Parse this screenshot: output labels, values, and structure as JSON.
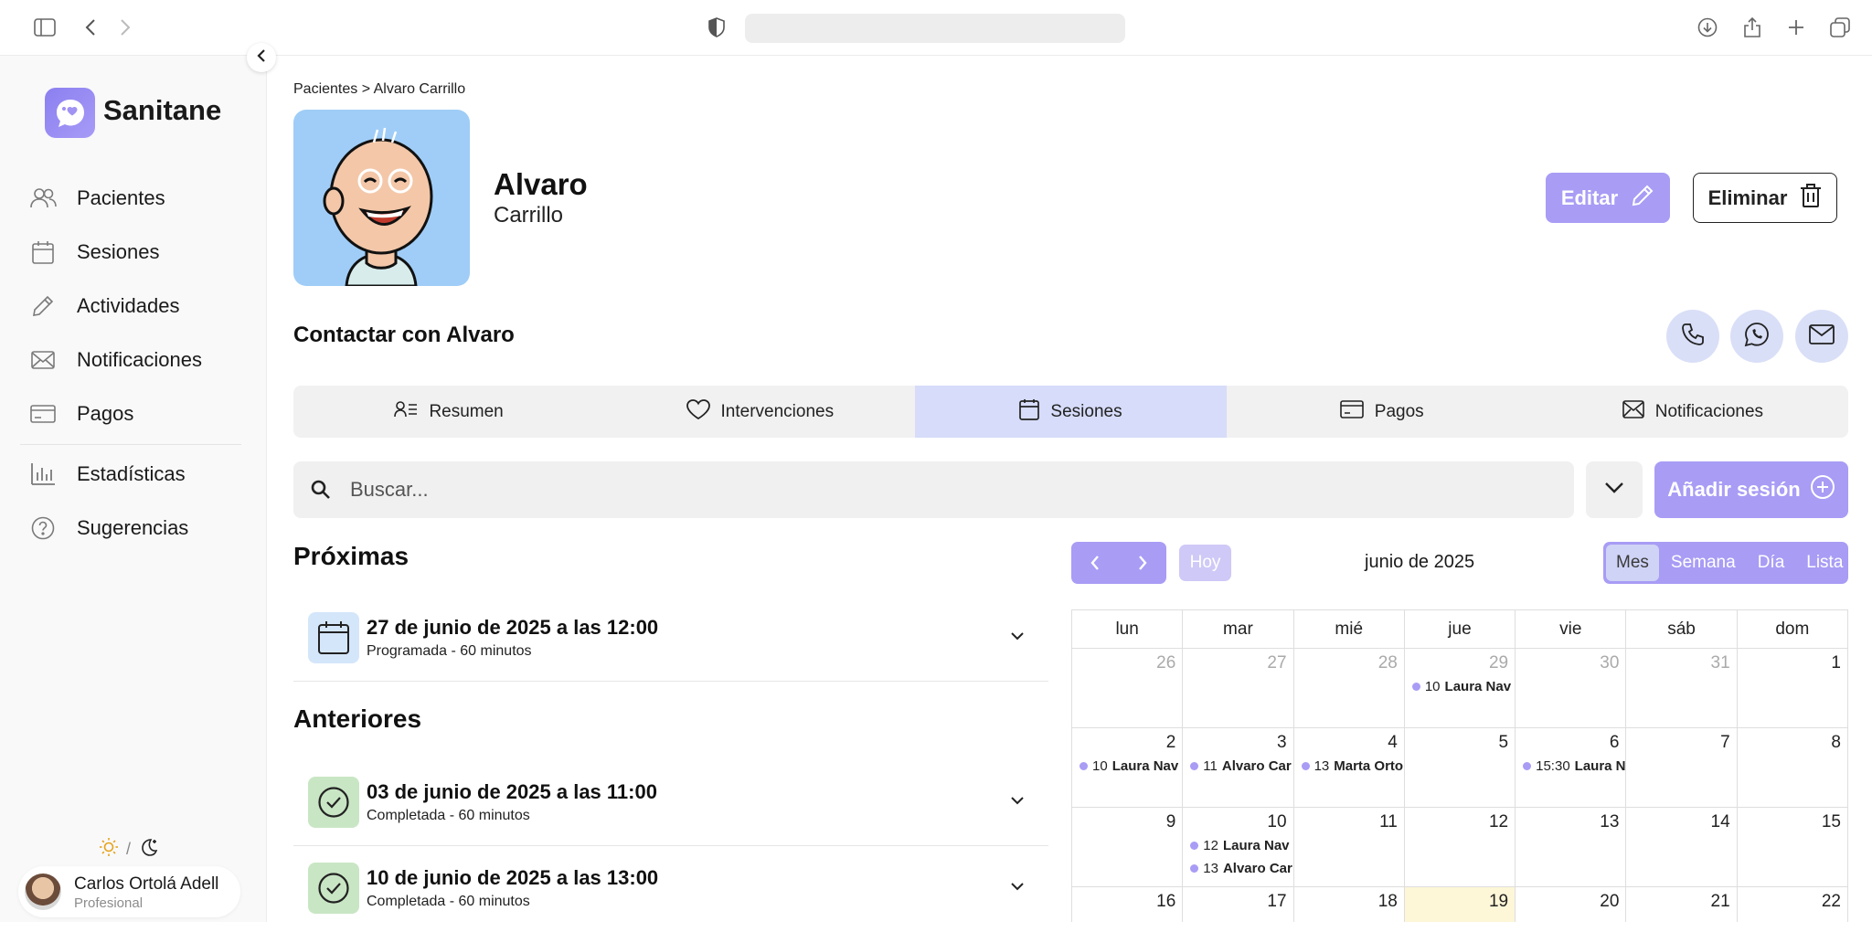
{
  "app": {
    "brand": "Sanitane"
  },
  "sidebar": {
    "items": [
      {
        "label": "Pacientes",
        "icon": "users-icon"
      },
      {
        "label": "Sesiones",
        "icon": "calendar-icon"
      },
      {
        "label": "Actividades",
        "icon": "pencil-icon"
      },
      {
        "label": "Notificaciones",
        "icon": "mail-icon"
      },
      {
        "label": "Pagos",
        "icon": "card-icon"
      },
      {
        "label": "Estadísticas",
        "icon": "bar-chart-icon"
      },
      {
        "label": "Sugerencias",
        "icon": "help-icon"
      }
    ],
    "theme_separator": "/",
    "user": {
      "name": "Carlos Ortolá Adell",
      "role": "Profesional"
    }
  },
  "breadcrumb": "Pacientes > Alvaro Carrillo",
  "patient": {
    "first_name": "Alvaro",
    "last_name": "Carrillo"
  },
  "actions": {
    "edit": "Editar",
    "delete": "Eliminar"
  },
  "contact": {
    "title": "Contactar con Alvaro"
  },
  "tabs": [
    {
      "label": "Resumen",
      "icon": "profile-list-icon",
      "active": false
    },
    {
      "label": "Intervenciones",
      "icon": "heart-icon",
      "active": false
    },
    {
      "label": "Sesiones",
      "icon": "calendar-icon",
      "active": true
    },
    {
      "label": "Pagos",
      "icon": "card-icon",
      "active": false
    },
    {
      "label": "Notificaciones",
      "icon": "mail-icon",
      "active": false
    }
  ],
  "search": {
    "placeholder": "Buscar..."
  },
  "add_session": "Añadir sesión",
  "upcoming": {
    "title": "Próximas",
    "items": [
      {
        "date": "27 de junio de 2025 a las 12:00",
        "sub": "Programada - 60 minutos"
      }
    ]
  },
  "previous": {
    "title": "Anteriores",
    "items": [
      {
        "date": "03 de junio de 2025 a las 11:00",
        "sub": "Completada - 60 minutos"
      },
      {
        "date": "10 de junio de 2025 a las 13:00",
        "sub": "Completada - 60 minutos"
      }
    ]
  },
  "calendar": {
    "today_label": "Hoy",
    "title": "junio de 2025",
    "views": [
      "Mes",
      "Semana",
      "Día",
      "Lista"
    ],
    "active_view": "Mes",
    "weekdays": [
      "lun",
      "mar",
      "mié",
      "jue",
      "vie",
      "sáb",
      "dom"
    ],
    "weeks": [
      [
        {
          "n": "26",
          "muted": true,
          "events": []
        },
        {
          "n": "27",
          "muted": true,
          "events": []
        },
        {
          "n": "28",
          "muted": true,
          "events": []
        },
        {
          "n": "29",
          "muted": true,
          "events": [
            {
              "time": "10",
              "name": "Laura Nav"
            }
          ]
        },
        {
          "n": "30",
          "muted": true,
          "events": []
        },
        {
          "n": "31",
          "muted": true,
          "events": []
        },
        {
          "n": "1",
          "muted": false,
          "events": []
        }
      ],
      [
        {
          "n": "2",
          "muted": false,
          "events": [
            {
              "time": "10",
              "name": "Laura Nav"
            }
          ]
        },
        {
          "n": "3",
          "muted": false,
          "events": [
            {
              "time": "11",
              "name": "Alvaro Car"
            }
          ]
        },
        {
          "n": "4",
          "muted": false,
          "events": [
            {
              "time": "13",
              "name": "Marta Orto"
            }
          ]
        },
        {
          "n": "5",
          "muted": false,
          "events": []
        },
        {
          "n": "6",
          "muted": false,
          "events": [
            {
              "time": "15:30",
              "name": "Laura N"
            }
          ]
        },
        {
          "n": "7",
          "muted": false,
          "events": []
        },
        {
          "n": "8",
          "muted": false,
          "events": []
        }
      ],
      [
        {
          "n": "9",
          "muted": false,
          "events": []
        },
        {
          "n": "10",
          "muted": false,
          "events": [
            {
              "time": "12",
              "name": "Laura Nav"
            },
            {
              "time": "13",
              "name": "Alvaro Car"
            }
          ]
        },
        {
          "n": "11",
          "muted": false,
          "events": []
        },
        {
          "n": "12",
          "muted": false,
          "events": []
        },
        {
          "n": "13",
          "muted": false,
          "events": []
        },
        {
          "n": "14",
          "muted": false,
          "events": []
        },
        {
          "n": "15",
          "muted": false,
          "events": []
        }
      ],
      [
        {
          "n": "16",
          "muted": false,
          "events": []
        },
        {
          "n": "17",
          "muted": false,
          "events": []
        },
        {
          "n": "18",
          "muted": false,
          "events": []
        },
        {
          "n": "19",
          "muted": false,
          "today": true,
          "events": []
        },
        {
          "n": "20",
          "muted": false,
          "events": []
        },
        {
          "n": "21",
          "muted": false,
          "events": []
        },
        {
          "n": "22",
          "muted": false,
          "events": []
        }
      ]
    ]
  },
  "colors": {
    "accent": "#a89cf5",
    "active_tab": "#d6dcf9",
    "today": "#fdf6d7"
  }
}
